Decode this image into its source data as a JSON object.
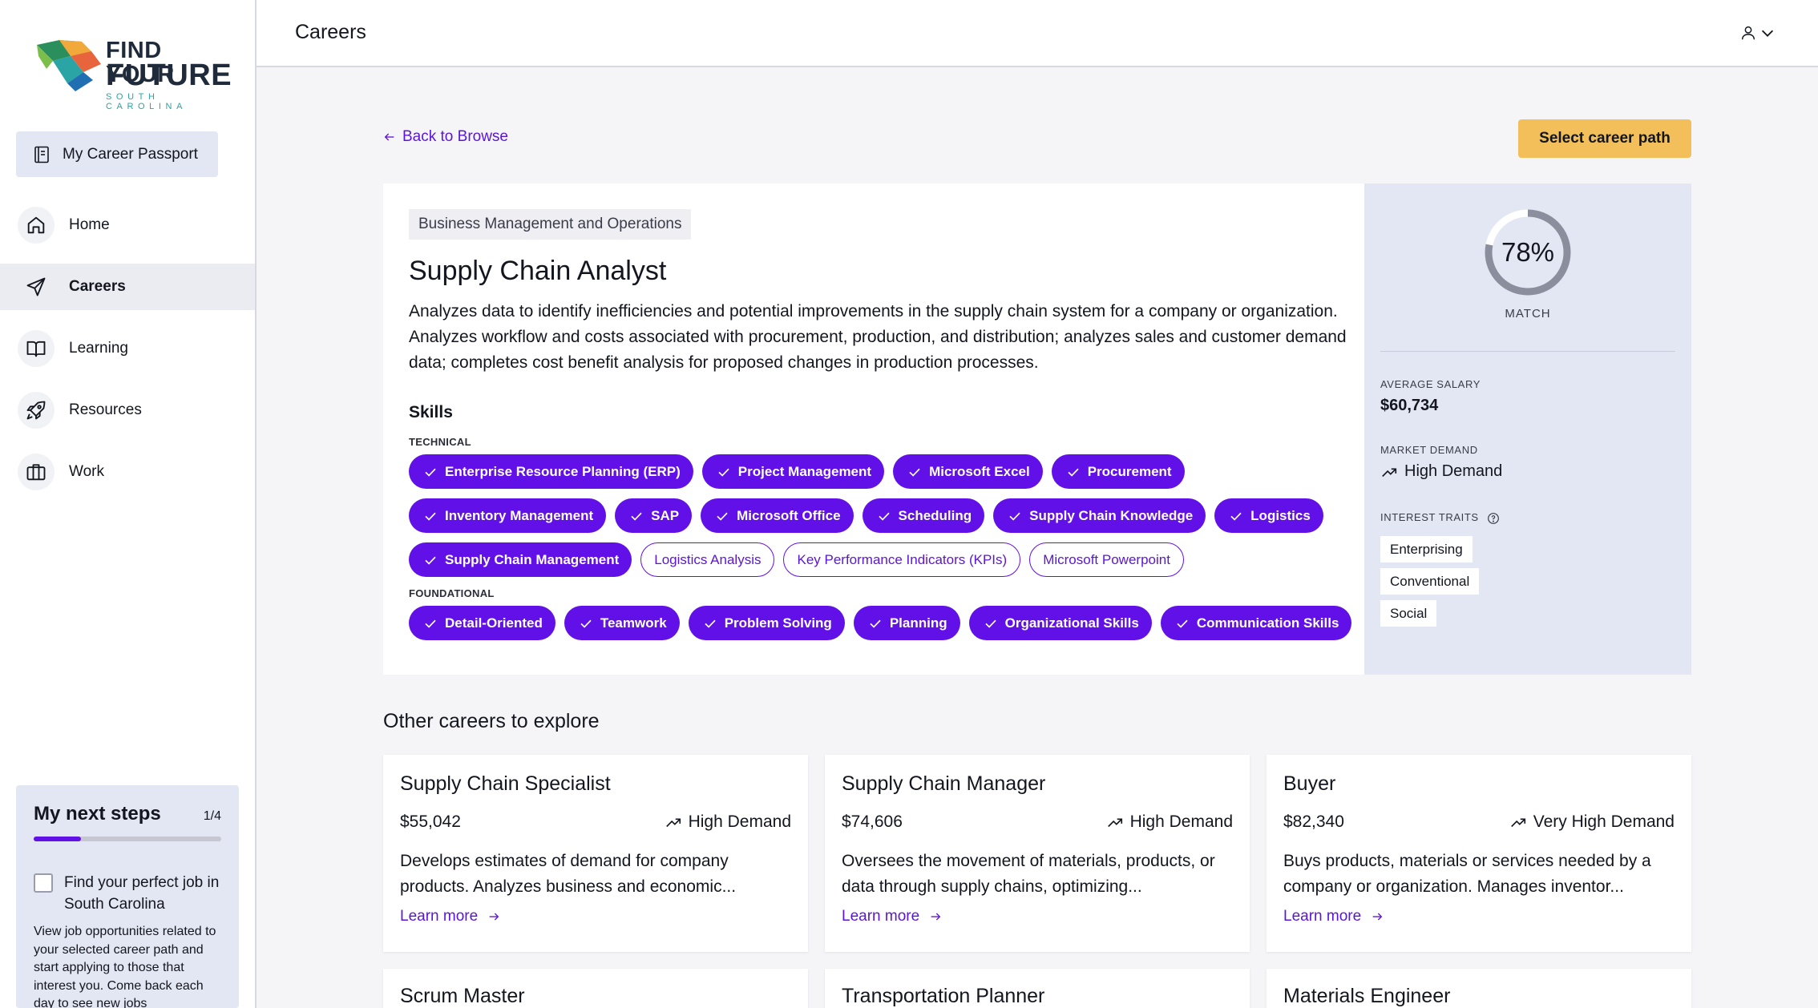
{
  "logo": {
    "line1": "FIND YOUR",
    "line2": "FUTURE",
    "line3": "SOUTH CAROLINA"
  },
  "sidebar": {
    "passport_label": "My Career Passport",
    "items": [
      {
        "label": "Home",
        "icon": "home-icon"
      },
      {
        "label": "Careers",
        "icon": "send-icon",
        "active": true
      },
      {
        "label": "Learning",
        "icon": "book-icon"
      },
      {
        "label": "Resources",
        "icon": "rocket-icon"
      },
      {
        "label": "Work",
        "icon": "briefcase-icon"
      }
    ],
    "next_steps": {
      "title": "My next steps",
      "count": "1/4",
      "progress": 0.25,
      "task_title": "Find your perfect job in South Carolina",
      "task_desc": "View job opportunities related to your selected career path and start applying to those that interest you. Come back each day to see new jobs"
    }
  },
  "header": {
    "title": "Careers",
    "user_icon": "user-icon"
  },
  "main": {
    "back_label": "Back to Browse",
    "select_label": "Select career path",
    "category": "Business Management and Operations",
    "title": "Supply Chain Analyst",
    "description": "Analyzes data to identify inefficiencies and potential improvements in the supply chain system for a company or organization. Analyzes workflow and costs associated with procurement, production, and distribution; analyzes sales and customer demand data; completes cost benefit analysis for proposed changes in production processes.",
    "skills_title": "Skills",
    "technical_label": "TECHNICAL",
    "foundational_label": "FOUNDATIONAL",
    "technical": [
      {
        "label": "Enterprise Resource Planning (ERP)",
        "selected": true
      },
      {
        "label": "Project Management",
        "selected": true
      },
      {
        "label": "Microsoft Excel",
        "selected": true
      },
      {
        "label": "Procurement",
        "selected": true
      },
      {
        "label": "Inventory Management",
        "selected": true
      },
      {
        "label": "SAP",
        "selected": true
      },
      {
        "label": "Microsoft Office",
        "selected": true
      },
      {
        "label": "Scheduling",
        "selected": true
      },
      {
        "label": "Supply Chain Knowledge",
        "selected": true
      },
      {
        "label": "Logistics",
        "selected": true
      },
      {
        "label": "Supply Chain Management",
        "selected": true
      },
      {
        "label": "Logistics Analysis",
        "selected": false
      },
      {
        "label": "Key Performance Indicators (KPIs)",
        "selected": false
      },
      {
        "label": "Microsoft Powerpoint",
        "selected": false
      }
    ],
    "foundational": [
      {
        "label": "Detail-Oriented",
        "selected": true
      },
      {
        "label": "Teamwork",
        "selected": true
      },
      {
        "label": "Problem Solving",
        "selected": true
      },
      {
        "label": "Planning",
        "selected": true
      },
      {
        "label": "Organizational Skills",
        "selected": true
      },
      {
        "label": "Communication Skills",
        "selected": true
      }
    ]
  },
  "panel": {
    "match_value": 78,
    "match_text": "78%",
    "match_label": "MATCH",
    "salary_label": "AVERAGE SALARY",
    "salary_value": "$60,734",
    "demand_label": "MARKET DEMAND",
    "demand_value": "High Demand",
    "traits_label": "INTEREST TRAITS",
    "traits": [
      "Enterprising",
      "Conventional",
      "Social"
    ]
  },
  "other": {
    "title": "Other careers to explore",
    "learn_more": "Learn more",
    "cards": [
      {
        "title": "Supply Chain Specialist",
        "salary": "$55,042",
        "demand": "High Demand",
        "desc": "Develops estimates of demand for company products. Analyzes business and economic..."
      },
      {
        "title": "Supply Chain Manager",
        "salary": "$74,606",
        "demand": "High Demand",
        "desc": "Oversees the movement of materials, products, or data through supply chains, optimizing..."
      },
      {
        "title": "Buyer",
        "salary": "$82,340",
        "demand": "Very High Demand",
        "desc": "Buys products, materials or services needed by a company or organization. Manages inventor..."
      },
      {
        "title": "Scrum Master"
      },
      {
        "title": "Transportation Planner"
      },
      {
        "title": "Materials Engineer"
      }
    ]
  },
  "colors": {
    "accent": "#6210e8",
    "button": "#f2bf5b",
    "panel": "#e2e7f3",
    "link": "#5b15d6"
  }
}
